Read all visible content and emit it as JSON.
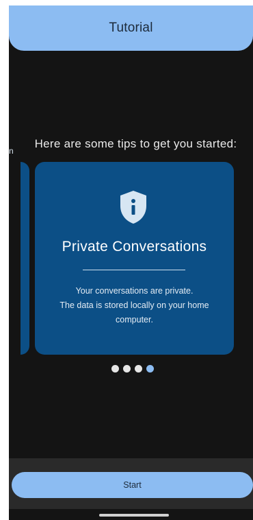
{
  "header": {
    "title": "Tutorial"
  },
  "intro": {
    "heading": "Here are some tips to get you started:"
  },
  "carousel": {
    "previous_card_fragment": "n",
    "current_card": {
      "icon": "shield-info-icon",
      "title": "Private Conversations",
      "body_line1": "Your conversations are private.",
      "body_line2": "The data is stored locally on your home computer."
    },
    "page_count": 4,
    "active_page": 4
  },
  "footer": {
    "start_label": "Start"
  },
  "colors": {
    "accent": "#8cbcf2",
    "card": "#0c4f86",
    "background": "#141414"
  }
}
